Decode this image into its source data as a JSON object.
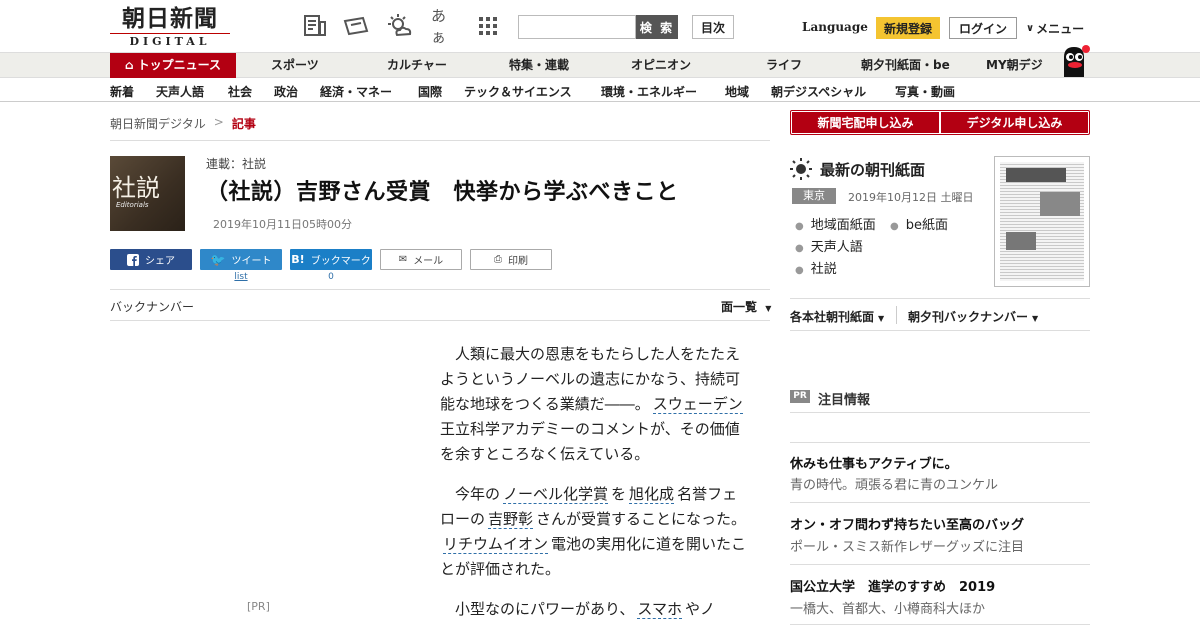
{
  "header": {
    "logo_main": "朝日新聞",
    "logo_sub": "DIGITAL",
    "search_placeholder": "",
    "search_button": "検 索",
    "index_button": "目次",
    "language": "Language",
    "register": "新規登録",
    "login": "ログイン",
    "menu": "メニュー",
    "font_size_icon": "あぁ"
  },
  "nav": {
    "top": "トップニュース",
    "items": [
      "スポーツ",
      "カルチャー",
      "特集・連載",
      "オピニオン",
      "ライフ",
      "朝夕刊紙面・be",
      "MY朝デジ"
    ]
  },
  "subnav": {
    "items": [
      "新着",
      "天声人語",
      "社会",
      "政治",
      "経済・マネー",
      "国際",
      "テック＆サイエンス",
      "環境・エネルギー",
      "地域",
      "朝デジスペシャル",
      "写真・動画"
    ]
  },
  "breadcrumb": {
    "home": "朝日新聞デジタル",
    "sep": ">",
    "current": "記事"
  },
  "article": {
    "image_big": "社説",
    "image_small": "Editorials",
    "series": "連載：社説",
    "title": "（社説）吉野さん受賞　快挙から学ぶべきこと",
    "date": "2019年10月11日05時00分",
    "p1_a": "人類に最大の恩恵をもたらした人をたたえようというノーベルの遺志にかなう、持続可能な地球をつくる業績だ――。",
    "p1_kw1": "スウェーデン",
    "p1_b": "王立科学アカデミーのコメントが、その価値を余すところなく伝えている。",
    "p2_a": "今年の",
    "p2_kw1": "ノーベル化学賞",
    "p2_b": "を",
    "p2_kw2": "旭化成",
    "p2_c": "名誉フェローの",
    "p2_kw3": "吉野彰",
    "p2_d": "さんが受賞することになった。",
    "p2_kw4": "リチウムイオン",
    "p2_e": "電池の実用化に道を開いたことが評価された。",
    "p3_a": "小型なのにパワーがあり、",
    "p3_kw1": "スマホ",
    "p3_b": "やノ"
  },
  "share": {
    "facebook": "シェア",
    "twitter": "ツイート",
    "hatena": "ブックマーク",
    "mail": "メール",
    "print": "印刷",
    "twitter_count": "list",
    "hatena_count": "0"
  },
  "backnumber": "バックナンバー",
  "pagelist": "面一覧",
  "pr_label": "[PR]",
  "sidebar": {
    "btn_delivery": "新聞宅配申し込み",
    "btn_digital": "デジタル申し込み",
    "title": "最新の朝刊紙面",
    "region": "東京",
    "date": "2019年10月12日 土曜日",
    "links": [
      "地域面紙面",
      "be紙面",
      "天声人語",
      "社説"
    ],
    "drop1": "各本社朝刊紙面",
    "drop2": "朝夕刊バックナンバー",
    "pr_badge": "PR",
    "pr_title": "注目情報",
    "ads": [
      {
        "title": "休みも仕事もアクティブに。",
        "sub": "青の時代。頑張る君に青のユンケル"
      },
      {
        "title": "オン・オフ問わず持ちたい至高のバッグ",
        "sub": "ポール・スミス新作レザーグッズに注目"
      },
      {
        "title": "国公立大学　進学のすすめ　2019",
        "sub": "一橋大、首都大、小樽商科大ほか"
      }
    ]
  },
  "colors": {
    "brand_red": "#b30012",
    "register_yellow": "#f4c431",
    "facebook": "#2b4e8c",
    "twitter": "#2f88c9",
    "hatena": "#1b7fc7"
  }
}
